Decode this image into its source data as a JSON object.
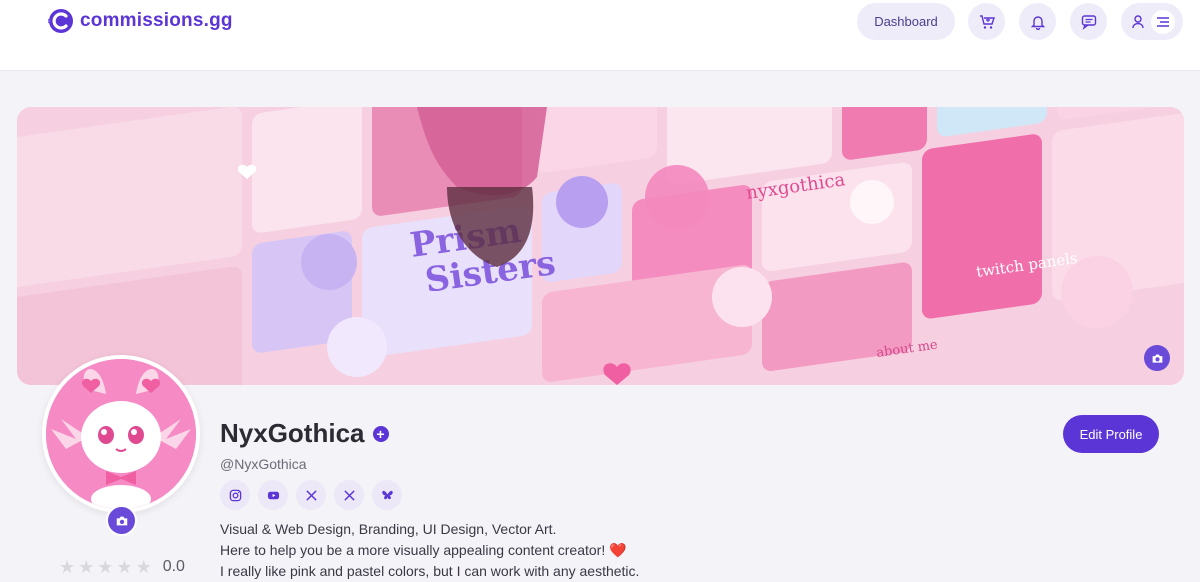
{
  "header": {
    "logo_text": "commissions.gg",
    "dashboard_label": "Dashboard",
    "icons": [
      "cart-icon",
      "bell-icon",
      "chat-icon",
      "user-icon",
      "menu-icon"
    ]
  },
  "banner": {
    "camera_icon": "camera-icon",
    "artwork_text": {
      "prism_line1": "Prism",
      "prism_line2": "Sisters",
      "brand": "nyxgothica",
      "panels": "twitch panels",
      "about": "about me"
    }
  },
  "profile": {
    "name": "NyxGothica",
    "handle": "@NyxGothica",
    "verified_icon": "plus-badge-icon",
    "edit_label": "Edit Profile",
    "rating_value": "0.0",
    "rating_stars": 0,
    "rating_max": 5,
    "socials": [
      "instagram-icon",
      "youtube-icon",
      "x-icon",
      "x-icon",
      "bluesky-icon"
    ],
    "bio": {
      "line1": "Visual & Web Design, Branding, UI Design, Vector Art.",
      "line2": "Here to help you be a more visually appealing content creator!",
      "line2_emoji": "❤️",
      "line3": "I really like pink and pastel colors, but I can work with any aesthetic."
    }
  },
  "colors": {
    "accent": "#5b35d5",
    "pill_bg": "#efecf9",
    "banner_pink": "#f7d3e3",
    "avatar_pink": "#f58ac4"
  }
}
